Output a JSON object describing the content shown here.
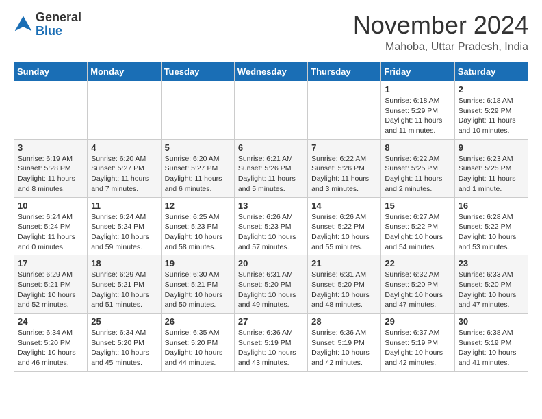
{
  "header": {
    "logo_line1": "General",
    "logo_line2": "Blue",
    "month_title": "November 2024",
    "location": "Mahoba, Uttar Pradesh, India"
  },
  "weekdays": [
    "Sunday",
    "Monday",
    "Tuesday",
    "Wednesday",
    "Thursday",
    "Friday",
    "Saturday"
  ],
  "weeks": [
    [
      {
        "day": "",
        "info": ""
      },
      {
        "day": "",
        "info": ""
      },
      {
        "day": "",
        "info": ""
      },
      {
        "day": "",
        "info": ""
      },
      {
        "day": "",
        "info": ""
      },
      {
        "day": "1",
        "info": "Sunrise: 6:18 AM\nSunset: 5:29 PM\nDaylight: 11 hours and 11 minutes."
      },
      {
        "day": "2",
        "info": "Sunrise: 6:18 AM\nSunset: 5:29 PM\nDaylight: 11 hours and 10 minutes."
      }
    ],
    [
      {
        "day": "3",
        "info": "Sunrise: 6:19 AM\nSunset: 5:28 PM\nDaylight: 11 hours and 8 minutes."
      },
      {
        "day": "4",
        "info": "Sunrise: 6:20 AM\nSunset: 5:27 PM\nDaylight: 11 hours and 7 minutes."
      },
      {
        "day": "5",
        "info": "Sunrise: 6:20 AM\nSunset: 5:27 PM\nDaylight: 11 hours and 6 minutes."
      },
      {
        "day": "6",
        "info": "Sunrise: 6:21 AM\nSunset: 5:26 PM\nDaylight: 11 hours and 5 minutes."
      },
      {
        "day": "7",
        "info": "Sunrise: 6:22 AM\nSunset: 5:26 PM\nDaylight: 11 hours and 3 minutes."
      },
      {
        "day": "8",
        "info": "Sunrise: 6:22 AM\nSunset: 5:25 PM\nDaylight: 11 hours and 2 minutes."
      },
      {
        "day": "9",
        "info": "Sunrise: 6:23 AM\nSunset: 5:25 PM\nDaylight: 11 hours and 1 minute."
      }
    ],
    [
      {
        "day": "10",
        "info": "Sunrise: 6:24 AM\nSunset: 5:24 PM\nDaylight: 11 hours and 0 minutes."
      },
      {
        "day": "11",
        "info": "Sunrise: 6:24 AM\nSunset: 5:24 PM\nDaylight: 10 hours and 59 minutes."
      },
      {
        "day": "12",
        "info": "Sunrise: 6:25 AM\nSunset: 5:23 PM\nDaylight: 10 hours and 58 minutes."
      },
      {
        "day": "13",
        "info": "Sunrise: 6:26 AM\nSunset: 5:23 PM\nDaylight: 10 hours and 57 minutes."
      },
      {
        "day": "14",
        "info": "Sunrise: 6:26 AM\nSunset: 5:22 PM\nDaylight: 10 hours and 55 minutes."
      },
      {
        "day": "15",
        "info": "Sunrise: 6:27 AM\nSunset: 5:22 PM\nDaylight: 10 hours and 54 minutes."
      },
      {
        "day": "16",
        "info": "Sunrise: 6:28 AM\nSunset: 5:22 PM\nDaylight: 10 hours and 53 minutes."
      }
    ],
    [
      {
        "day": "17",
        "info": "Sunrise: 6:29 AM\nSunset: 5:21 PM\nDaylight: 10 hours and 52 minutes."
      },
      {
        "day": "18",
        "info": "Sunrise: 6:29 AM\nSunset: 5:21 PM\nDaylight: 10 hours and 51 minutes."
      },
      {
        "day": "19",
        "info": "Sunrise: 6:30 AM\nSunset: 5:21 PM\nDaylight: 10 hours and 50 minutes."
      },
      {
        "day": "20",
        "info": "Sunrise: 6:31 AM\nSunset: 5:20 PM\nDaylight: 10 hours and 49 minutes."
      },
      {
        "day": "21",
        "info": "Sunrise: 6:31 AM\nSunset: 5:20 PM\nDaylight: 10 hours and 48 minutes."
      },
      {
        "day": "22",
        "info": "Sunrise: 6:32 AM\nSunset: 5:20 PM\nDaylight: 10 hours and 47 minutes."
      },
      {
        "day": "23",
        "info": "Sunrise: 6:33 AM\nSunset: 5:20 PM\nDaylight: 10 hours and 47 minutes."
      }
    ],
    [
      {
        "day": "24",
        "info": "Sunrise: 6:34 AM\nSunset: 5:20 PM\nDaylight: 10 hours and 46 minutes."
      },
      {
        "day": "25",
        "info": "Sunrise: 6:34 AM\nSunset: 5:20 PM\nDaylight: 10 hours and 45 minutes."
      },
      {
        "day": "26",
        "info": "Sunrise: 6:35 AM\nSunset: 5:20 PM\nDaylight: 10 hours and 44 minutes."
      },
      {
        "day": "27",
        "info": "Sunrise: 6:36 AM\nSunset: 5:19 PM\nDaylight: 10 hours and 43 minutes."
      },
      {
        "day": "28",
        "info": "Sunrise: 6:36 AM\nSunset: 5:19 PM\nDaylight: 10 hours and 42 minutes."
      },
      {
        "day": "29",
        "info": "Sunrise: 6:37 AM\nSunset: 5:19 PM\nDaylight: 10 hours and 42 minutes."
      },
      {
        "day": "30",
        "info": "Sunrise: 6:38 AM\nSunset: 5:19 PM\nDaylight: 10 hours and 41 minutes."
      }
    ]
  ]
}
